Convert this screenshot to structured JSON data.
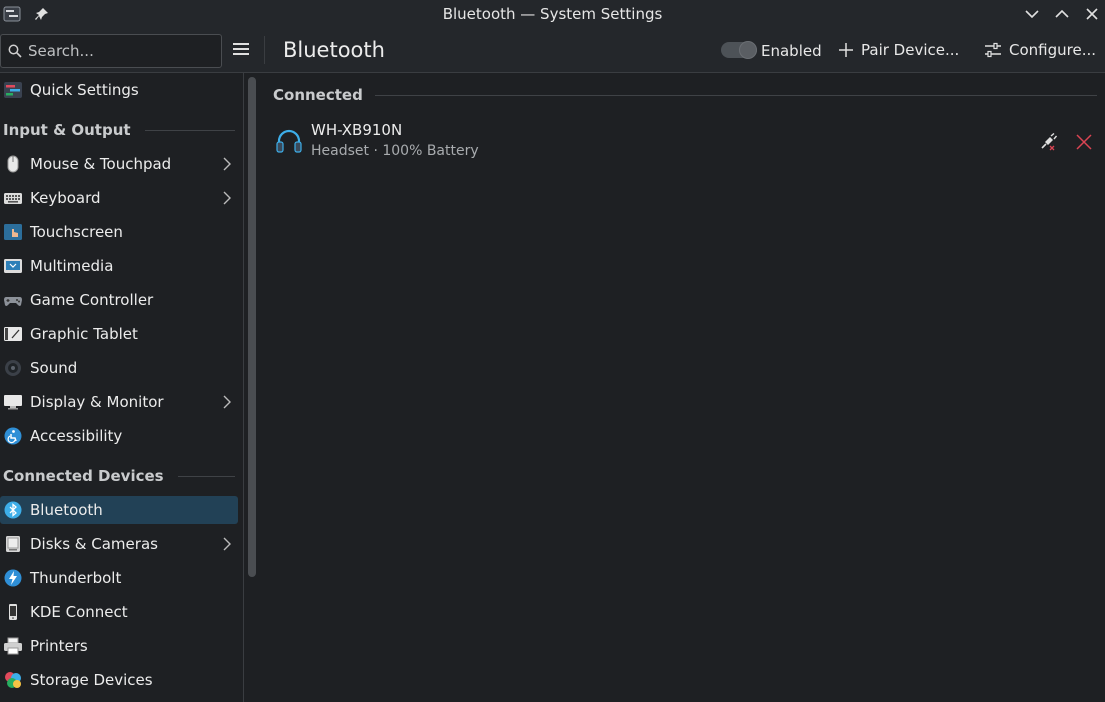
{
  "window": {
    "title": "Bluetooth — System Settings"
  },
  "toolbar": {
    "search_placeholder": "Search...",
    "page_title": "Bluetooth",
    "enabled_label": "Enabled",
    "enabled_state": true,
    "pair_label": "Pair Device...",
    "configure_label": "Configure..."
  },
  "sidebar": {
    "quick_settings": "Quick Settings",
    "section_input_output": "Input & Output",
    "mouse_touchpad": "Mouse & Touchpad",
    "keyboard": "Keyboard",
    "touchscreen": "Touchscreen",
    "multimedia": "Multimedia",
    "game_controller": "Game Controller",
    "graphic_tablet": "Graphic Tablet",
    "sound": "Sound",
    "display_monitor": "Display & Monitor",
    "accessibility": "Accessibility",
    "section_connected_devices": "Connected Devices",
    "bluetooth": "Bluetooth",
    "disks_cameras": "Disks & Cameras",
    "thunderbolt": "Thunderbolt",
    "kde_connect": "KDE Connect",
    "printers": "Printers",
    "storage_devices": "Storage Devices"
  },
  "main": {
    "section_connected": "Connected",
    "device": {
      "name": "WH-XB910N",
      "subtitle": "Headset · 100% Battery",
      "icon": "headphones-icon"
    }
  },
  "colors": {
    "background": "#1e2023",
    "titlebar": "#24272b",
    "selection": "#224156",
    "accent": "#3daee9",
    "remove_red": "#da4453"
  }
}
